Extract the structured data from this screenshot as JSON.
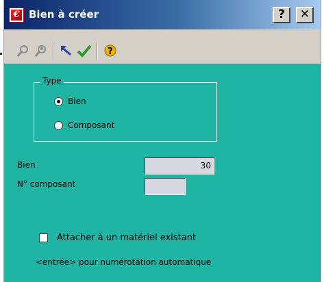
{
  "window": {
    "title": "Bien à créer",
    "help_label": "?",
    "close_label": "✕"
  },
  "toolbar": {
    "tools": [
      {
        "icon": "magnifier-icon",
        "glyph": "⚲"
      },
      {
        "icon": "search-person-icon",
        "glyph": "⚲"
      },
      {
        "icon": "undo-arrow-icon",
        "glyph": "↶"
      },
      {
        "icon": "checkmark-icon",
        "glyph": "✔"
      },
      {
        "icon": "help-circle-icon",
        "glyph": "?"
      }
    ]
  },
  "form": {
    "type_group_label": "Type",
    "radio_options": [
      "Bien",
      "Composant"
    ],
    "selected_option": "Bien",
    "bien_label": "Bien",
    "bien_value": "30",
    "composant_label": "N° composant",
    "composant_value": "",
    "attach_checkbox_label": "Attacher à un matériel existant",
    "attach_checked": false,
    "hint_text": "<entrée> pour numérotation automatique"
  },
  "colors": {
    "panel": "#1fb5a5",
    "titlebar_start": "#0a246a",
    "titlebar_end": "#a6caf0",
    "checkmark": "#2a9a2a",
    "undo_arrow": "#1f3fae",
    "help_icon": "#f0b000"
  }
}
